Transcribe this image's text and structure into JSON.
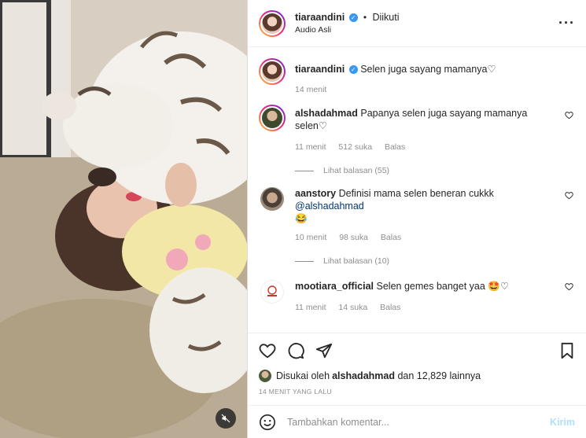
{
  "header": {
    "username": "tiaraandini",
    "dot": "•",
    "follow_status": "Diikuti",
    "audio": "Audio Asli"
  },
  "caption": {
    "username": "tiaraandini",
    "text": "Selen juga sayang mamanya♡",
    "time": "14 menit"
  },
  "comments": [
    {
      "username": "alshadahmad",
      "text": "Papanya selen juga sayang mamanya selen♡",
      "time": "11 menit",
      "likes": "512 suka",
      "reply": "Balas",
      "view_replies": "Lihat balasan (55)"
    },
    {
      "username": "aanstory",
      "text": "Definisi mama selen beneran cukkk ",
      "mention": "@alshadahmad",
      "emoji": "😂",
      "time": "10 menit",
      "likes": "98 suka",
      "reply": "Balas",
      "view_replies": "Lihat balasan (10)"
    },
    {
      "username": "mootiara_official",
      "text": "Selen gemes banget yaa 🤩♡",
      "time": "11 menit",
      "likes": "14 suka",
      "reply": "Balas"
    }
  ],
  "likes": {
    "prefix": "Disukai oleh ",
    "user": "alshadahmad",
    "middle": " dan ",
    "count": "12,829 lainnya"
  },
  "timestamp": "14 MENIT YANG LALU",
  "composer": {
    "placeholder": "Tambahkan komentar...",
    "post_label": "Kirim"
  },
  "colors": {
    "verified": "#3897f0",
    "mention": "#00376b",
    "post_disabled": "#b2dffc"
  }
}
